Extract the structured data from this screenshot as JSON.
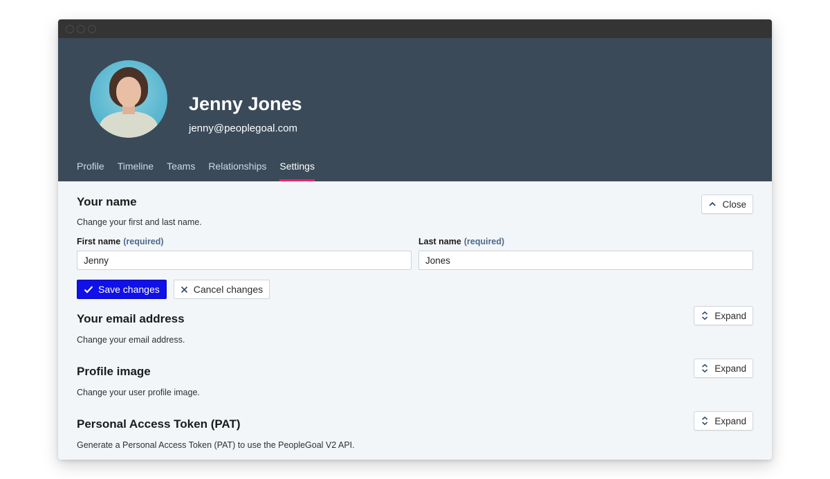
{
  "user": {
    "name": "Jenny Jones",
    "email": "jenny@peoplegoal.com"
  },
  "tabs": [
    {
      "label": "Profile"
    },
    {
      "label": "Timeline"
    },
    {
      "label": "Teams"
    },
    {
      "label": "Relationships"
    },
    {
      "label": "Settings",
      "active": true
    }
  ],
  "colors": {
    "header_bg": "#3a4a59",
    "tab_indicator": "#e5286d",
    "primary_button": "#1010e8"
  },
  "sections": {
    "name": {
      "title": "Your name",
      "description": "Change your first and last name.",
      "toggle_label": "Close",
      "toggle_icon": "chevron-up-icon",
      "first_name": {
        "label": "First name",
        "required": "(required)",
        "value": "Jenny"
      },
      "last_name": {
        "label": "Last name",
        "required": "(required)",
        "value": "Jones"
      },
      "save_label": "Save changes",
      "cancel_label": "Cancel changes"
    },
    "email": {
      "title": "Your email address",
      "description": "Change your email address.",
      "toggle_label": "Expand",
      "toggle_icon": "expand-icon"
    },
    "image": {
      "title": "Profile image",
      "description": "Change your user profile image.",
      "toggle_label": "Expand",
      "toggle_icon": "expand-icon"
    },
    "pat": {
      "title": "Personal Access Token (PAT)",
      "description": "Generate a Personal Access Token (PAT) to use the PeopleGoal V2 API.",
      "toggle_label": "Expand",
      "toggle_icon": "expand-icon"
    }
  }
}
